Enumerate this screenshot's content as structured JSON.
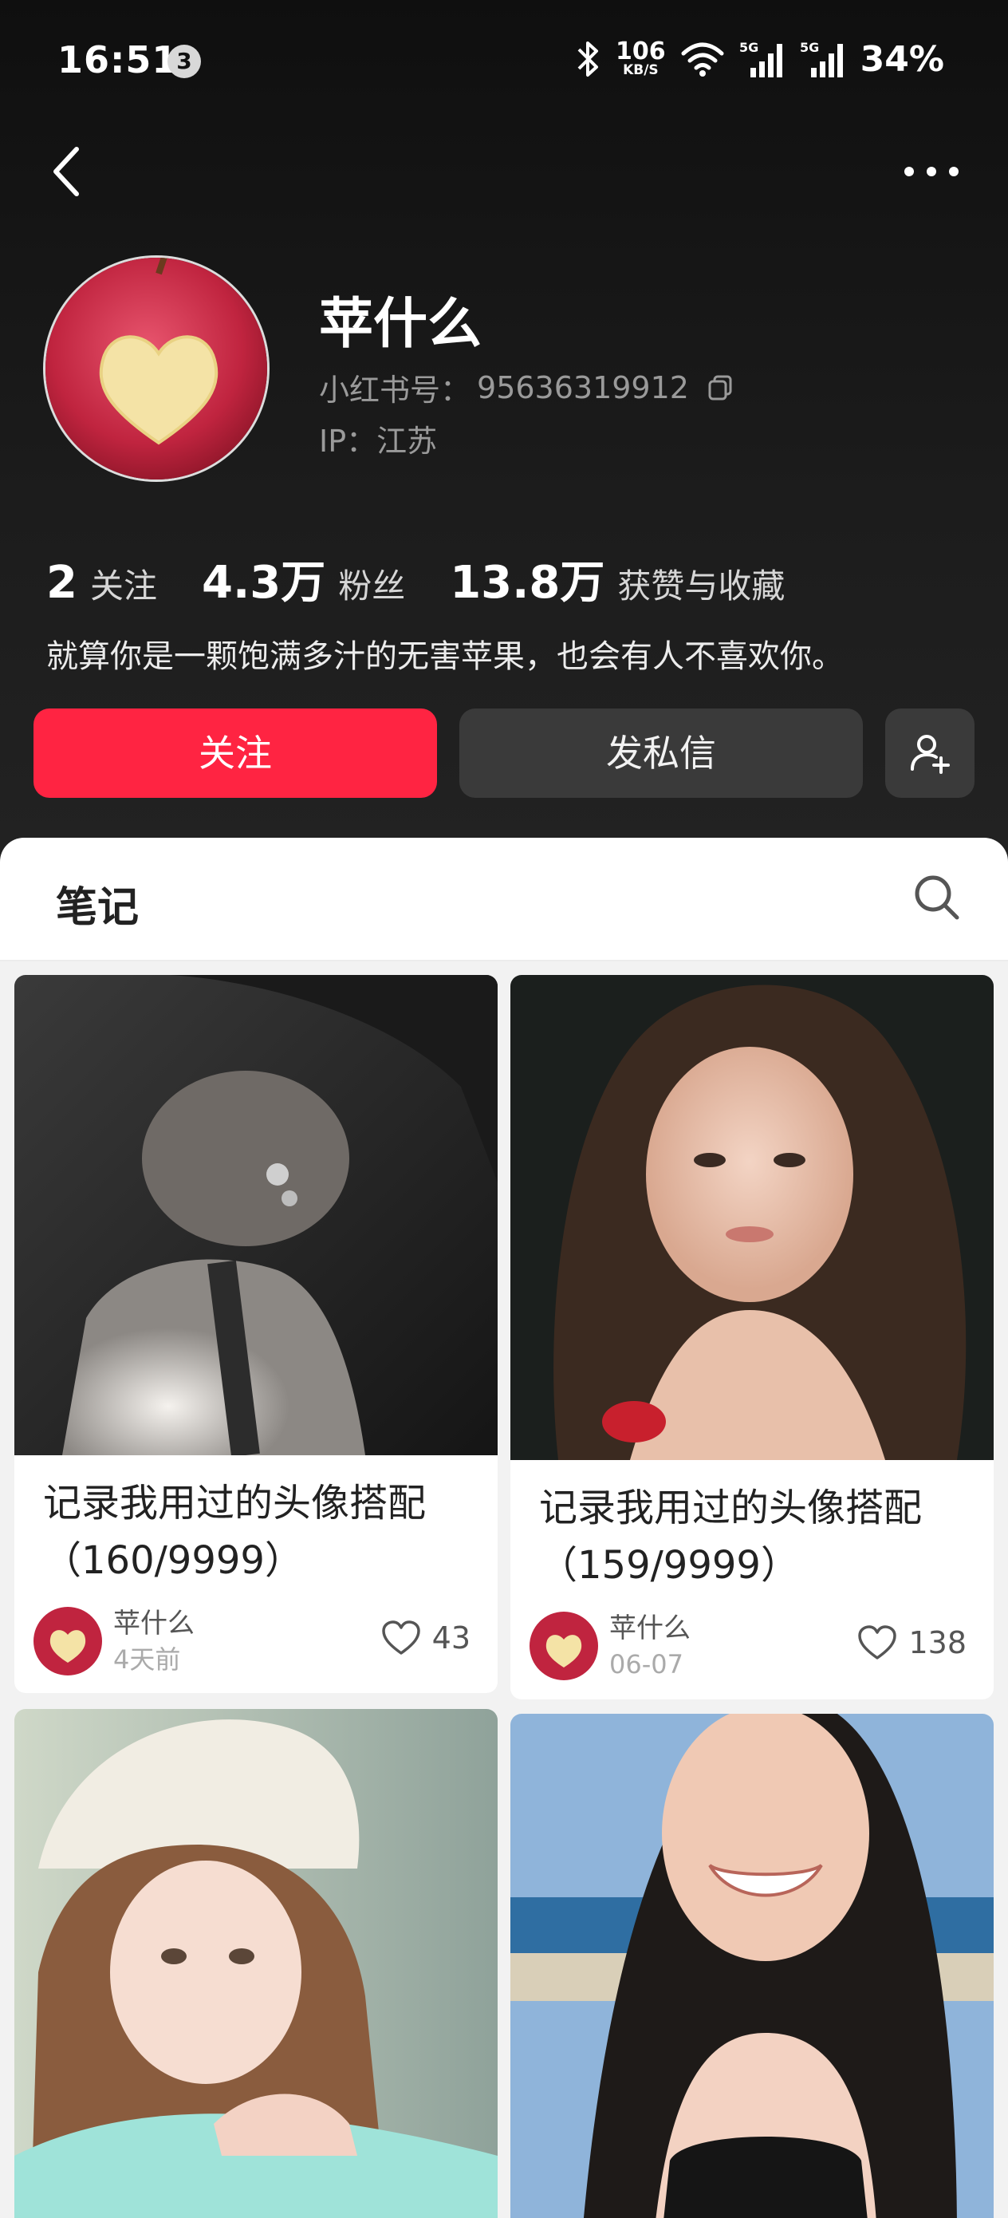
{
  "status_bar": {
    "time": "16:51",
    "notification_count": "3",
    "net_speed": "106",
    "net_speed_unit": "KB/S",
    "signal_1": "5G",
    "signal_2": "5G",
    "battery": "34%"
  },
  "nav": {
    "back_icon": "chevron-left-icon",
    "more_icon": "more-dots-icon"
  },
  "profile": {
    "nickname": "苹什么",
    "id_label": "小红书号：",
    "id_value": "95636319912",
    "ip_label": "IP：",
    "ip_value": "江苏",
    "bio": "就算你是一颗饱满多汁的无害苹果，也会有人不喜欢你。",
    "stats": [
      {
        "value": "2",
        "label": "关注"
      },
      {
        "value": "4.3万",
        "label": "粉丝"
      },
      {
        "value": "13.8万",
        "label": "获赞与收藏"
      }
    ]
  },
  "actions": {
    "follow": "关注",
    "message": "发私信",
    "add_friend_icon": "add-user-icon"
  },
  "tabs": {
    "notes": "笔记",
    "search_icon": "search-icon"
  },
  "notes": [
    {
      "title": "记录我用过的头像搭配（160/9999）",
      "author": "苹什么",
      "date": "4天前",
      "likes": "43"
    },
    {
      "title": "记录我用过的头像搭配（159/9999）",
      "author": "苹什么",
      "date": "06-07",
      "likes": "138"
    },
    {
      "title": "",
      "author": "",
      "date": "",
      "likes": ""
    },
    {
      "title": "",
      "author": "",
      "date": "",
      "likes": ""
    }
  ],
  "colors": {
    "accent": "#ff2442",
    "header_bg": "#1a1a1a",
    "secondary_button": "#3a3a3a"
  }
}
